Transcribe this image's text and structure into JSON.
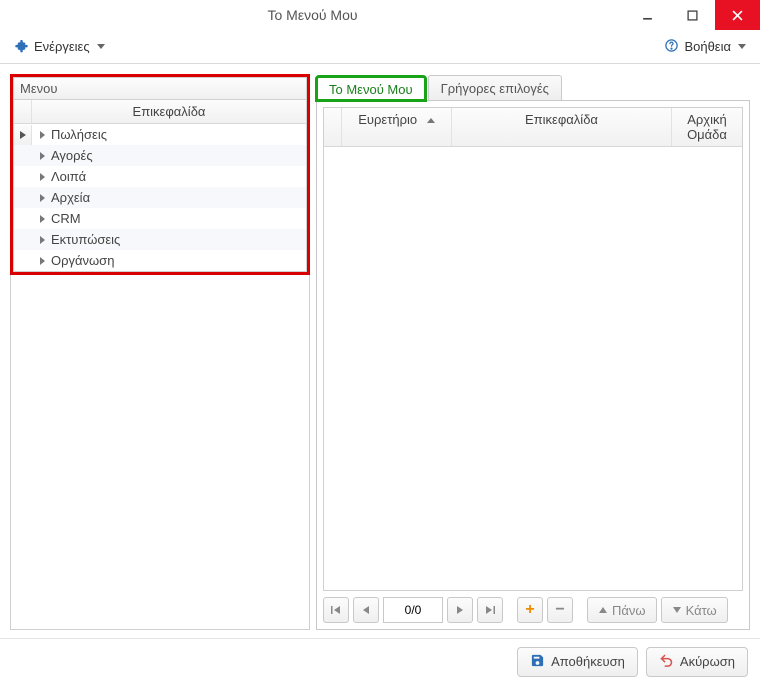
{
  "window": {
    "title": "Το Μενού Μου"
  },
  "toolbar": {
    "actions_label": "Ενέργειες",
    "help_label": "Βοήθεια"
  },
  "left": {
    "panel_label": "Μενου",
    "column_header": "Επικεφαλίδα",
    "rows": [
      "Πωλήσεις",
      "Αγορές",
      "Λοιπά",
      "Αρχεία",
      "CRM",
      "Εκτυπώσεις",
      "Οργάνωση"
    ]
  },
  "tabs": {
    "my_menu": "Το Μενού Μου",
    "quick": "Γρήγορες επιλογές"
  },
  "right_grid": {
    "col_index": "Ευρετήριο",
    "col_header": "Επικεφαλίδα",
    "col_group": "Αρχική Ομάδα"
  },
  "nav": {
    "page_display": "0/0",
    "up_label": "Πάνω",
    "down_label": "Κάτω"
  },
  "footer": {
    "save_label": "Αποθήκευση",
    "cancel_label": "Ακύρωση"
  }
}
